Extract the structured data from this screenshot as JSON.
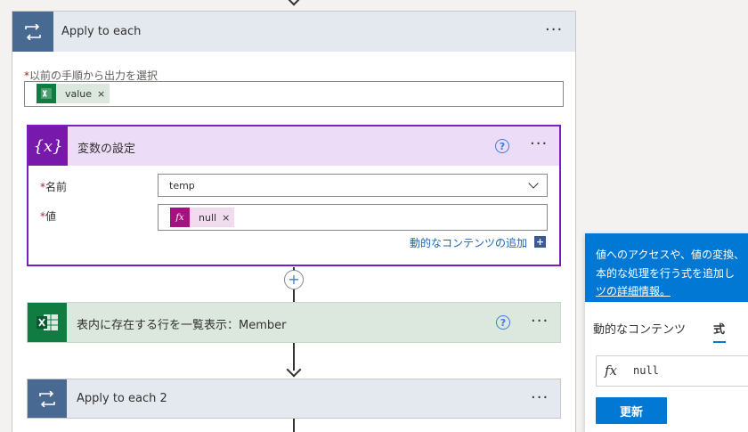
{
  "apply_each": {
    "title": "Apply to each",
    "field_label": "以前の手順から出力を選択",
    "token_label": "value",
    "token_close": "×",
    "menu": "···"
  },
  "set_variable": {
    "title": "変数の設定",
    "help": "?",
    "menu": "···",
    "name_label": "名前",
    "name_value": "temp",
    "value_label": "値",
    "value_token": "null",
    "token_close": "×",
    "add_dynamic_link": "動的なコンテンツの追加",
    "plus": "+"
  },
  "add_step": "+",
  "list_rows": {
    "title": "表内に存在する行を一覧表示：Member",
    "help": "?",
    "menu": "···"
  },
  "apply_each_2": {
    "title": "Apply to each 2",
    "menu": "···"
  },
  "dynamic_panel": {
    "info_line1": "値へのアクセスや、値の変換、",
    "info_line2": "本的な処理を行う式を追加し",
    "info_link": "ツの詳細情報。",
    "tab_dynamic": "動的なコンテンツ",
    "tab_expression": "式",
    "expression_value": "null",
    "update_button": "更新"
  },
  "colors": {
    "loop_blue": "#486991",
    "variable_purple": "#7719aa",
    "excel_green": "#107c41",
    "accent_blue": "#0078d4"
  }
}
